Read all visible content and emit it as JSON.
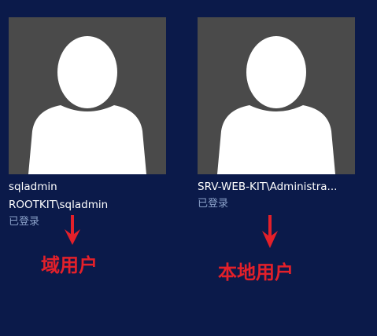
{
  "accounts": [
    {
      "display_name": "sqladmin",
      "domain_account": "ROOTKIT\\sqladmin",
      "status": "已登录",
      "avatar_icon": "user-silhouette-icon"
    },
    {
      "display_name": "SRV-WEB-KIT\\Administra...",
      "status": "已登录",
      "avatar_icon": "user-silhouette-icon"
    }
  ],
  "annotations": {
    "left_label": "域用户",
    "right_label": "本地用户",
    "arrow_icon": "down-arrow-icon",
    "annotation_color": "#e3202a"
  },
  "colors": {
    "background": "#0b1a4a",
    "tile": "#4a4a4a",
    "status_text": "#8aa0c8"
  }
}
